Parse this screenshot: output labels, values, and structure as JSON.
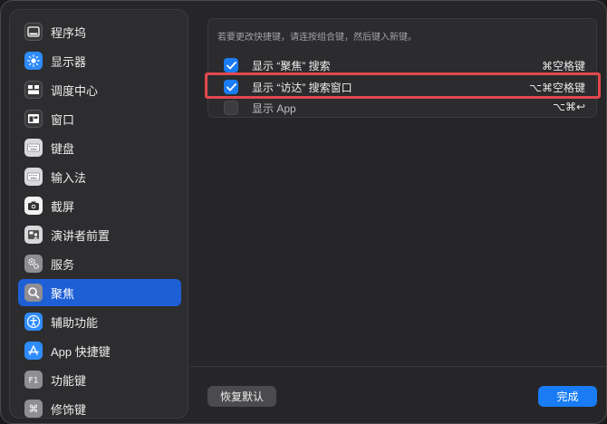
{
  "sidebar": {
    "items": [
      {
        "label": "程序坞",
        "icon": "dock-icon"
      },
      {
        "label": "显示器",
        "icon": "brightness-icon"
      },
      {
        "label": "调度中心",
        "icon": "mission-control-icon"
      },
      {
        "label": "窗口",
        "icon": "window-icon"
      },
      {
        "label": "键盘",
        "icon": "keyboard-icon"
      },
      {
        "label": "输入法",
        "icon": "input-method-icon"
      },
      {
        "label": "截屏",
        "icon": "camera-icon"
      },
      {
        "label": "演讲者前置",
        "icon": "presenter-overlay-icon"
      },
      {
        "label": "服务",
        "icon": "gear-icon"
      },
      {
        "label": "聚焦",
        "icon": "search-icon"
      },
      {
        "label": "辅助功能",
        "icon": "accessibility-icon"
      },
      {
        "label": "App 快捷键",
        "icon": "app-store-icon"
      },
      {
        "label": "功能键",
        "icon": "function-key-icon"
      },
      {
        "label": "修饰键",
        "icon": "command-key-icon"
      }
    ],
    "selected": "聚焦"
  },
  "main": {
    "hint": "若要更改快捷键，请连按组合键，然后键入新键。",
    "rows": [
      {
        "label": "显示 “聚焦” 搜索",
        "shortcut": "⌘空格键",
        "checked": true
      },
      {
        "label": "显示 “访达” 搜索窗口",
        "shortcut": "⌥⌘空格键",
        "checked": true
      },
      {
        "label": "显示 App",
        "shortcut": "⌥⌘↩",
        "checked": false
      }
    ]
  },
  "footer": {
    "restore_label": "恢复默认",
    "done_label": "完成"
  },
  "colors": {
    "accent": "#1a7cf5",
    "selection": "#1f5fd6",
    "highlight_border": "#e0484d"
  }
}
